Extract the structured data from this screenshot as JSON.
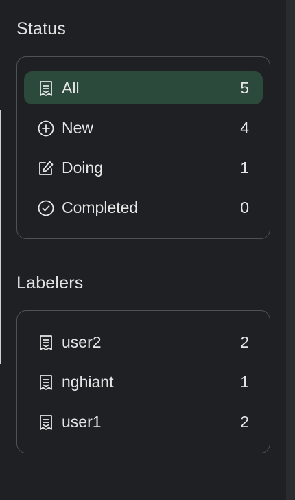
{
  "status": {
    "title": "Status",
    "items": [
      {
        "label": "All",
        "count": "5",
        "icon": "receipt-icon",
        "active": true
      },
      {
        "label": "New",
        "count": "4",
        "icon": "plus-circle-icon",
        "active": false
      },
      {
        "label": "Doing",
        "count": "1",
        "icon": "edit-icon",
        "active": false
      },
      {
        "label": "Completed",
        "count": "0",
        "icon": "check-circle-icon",
        "active": false
      }
    ]
  },
  "labelers": {
    "title": "Labelers",
    "items": [
      {
        "label": "user2",
        "count": "2",
        "icon": "receipt-icon"
      },
      {
        "label": "nghiant",
        "count": "1",
        "icon": "receipt-icon"
      },
      {
        "label": "user1",
        "count": "2",
        "icon": "receipt-icon"
      }
    ]
  },
  "colors": {
    "background": "#1f2023",
    "active_row": "#2c4a3b",
    "border": "#4f5156",
    "text": "#e6e6e6"
  }
}
